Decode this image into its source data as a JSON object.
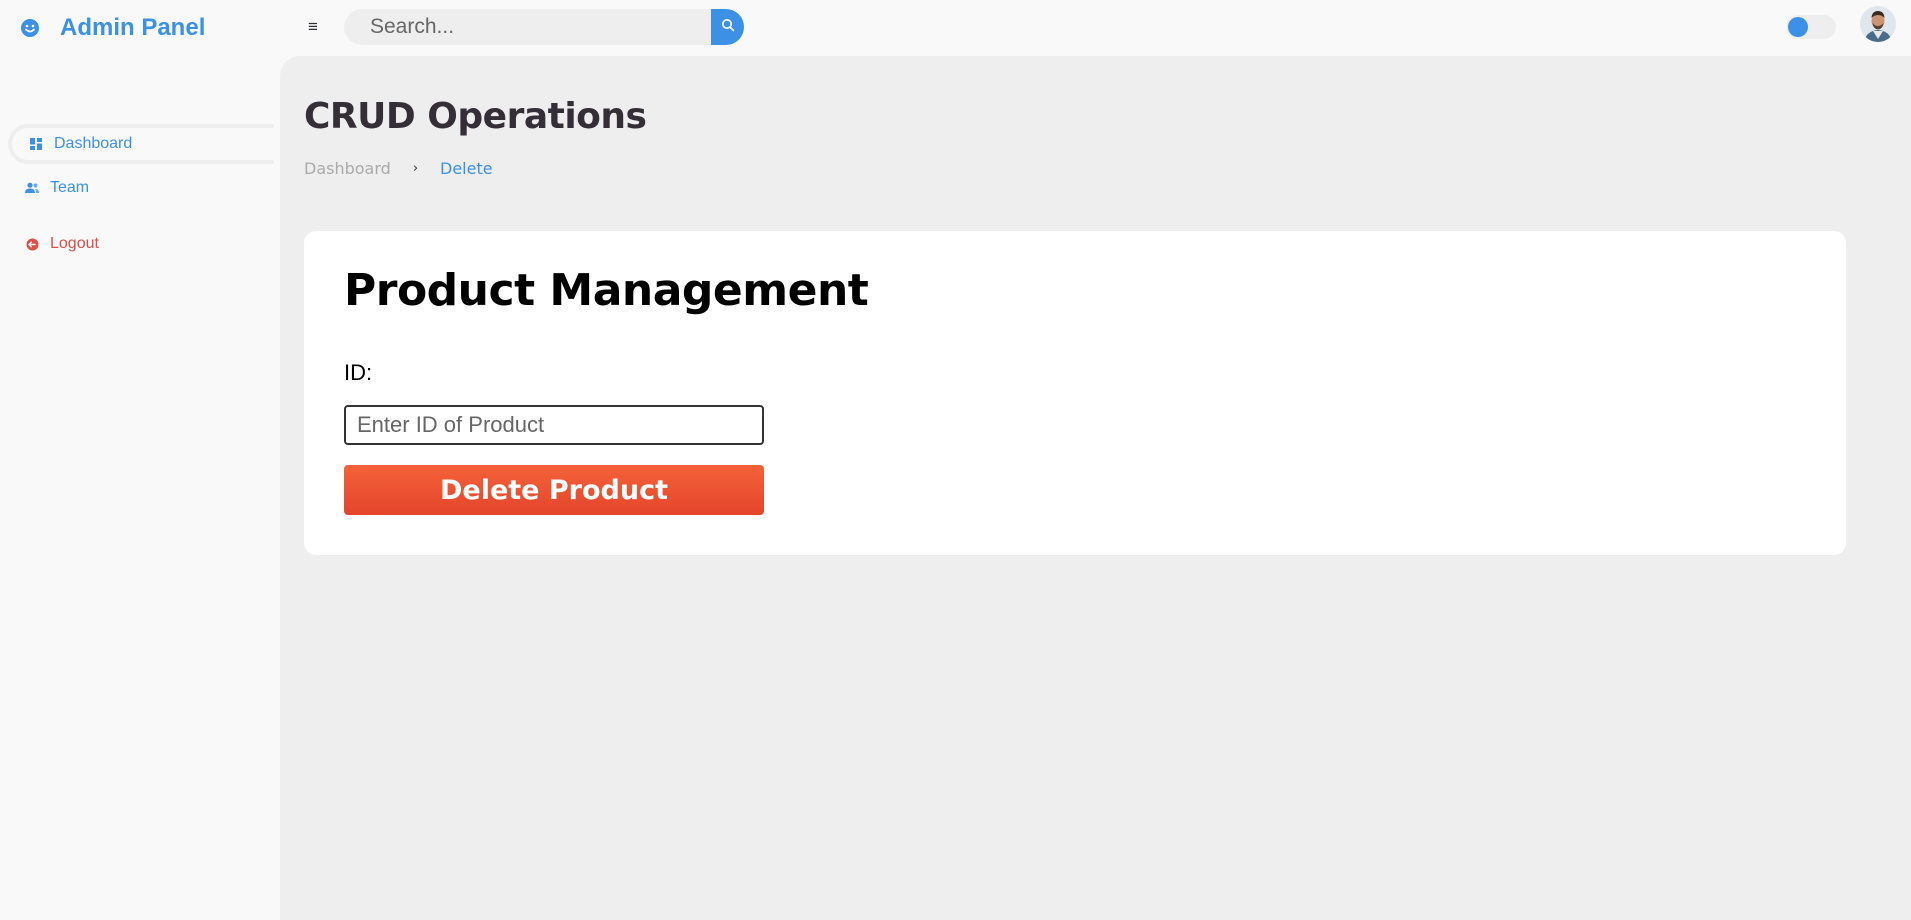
{
  "brand": {
    "name": "Admin Panel",
    "icon": "smiley-icon"
  },
  "topbar": {
    "menu_icon": "hamburger-icon",
    "menu_glyph": "≡",
    "search": {
      "placeholder": "Search...",
      "value": "",
      "button_icon": "search-icon"
    },
    "theme_toggle": {
      "state": "off"
    },
    "avatar": "user-avatar"
  },
  "sidebar": {
    "items": [
      {
        "label": "Dashboard",
        "icon": "dashboard-icon",
        "active": true
      },
      {
        "label": "Team",
        "icon": "team-icon",
        "active": false
      },
      {
        "label": "Logout",
        "icon": "logout-icon",
        "active": false
      }
    ]
  },
  "main": {
    "title": "CRUD Operations",
    "breadcrumb": [
      {
        "label": "Dashboard"
      },
      {
        "label": "Delete"
      }
    ],
    "breadcrumb_sep": "›",
    "card": {
      "title": "Product Management",
      "id_label": "ID:",
      "id_input": {
        "placeholder": "Enter ID of Product",
        "value": ""
      },
      "delete_button": "Delete Product"
    }
  },
  "colors": {
    "accent": "#3c91e6",
    "danger": "#db504a",
    "delete_button": "#f05a35",
    "background": "#f9f9f9",
    "content_bg": "#eeeeee"
  }
}
